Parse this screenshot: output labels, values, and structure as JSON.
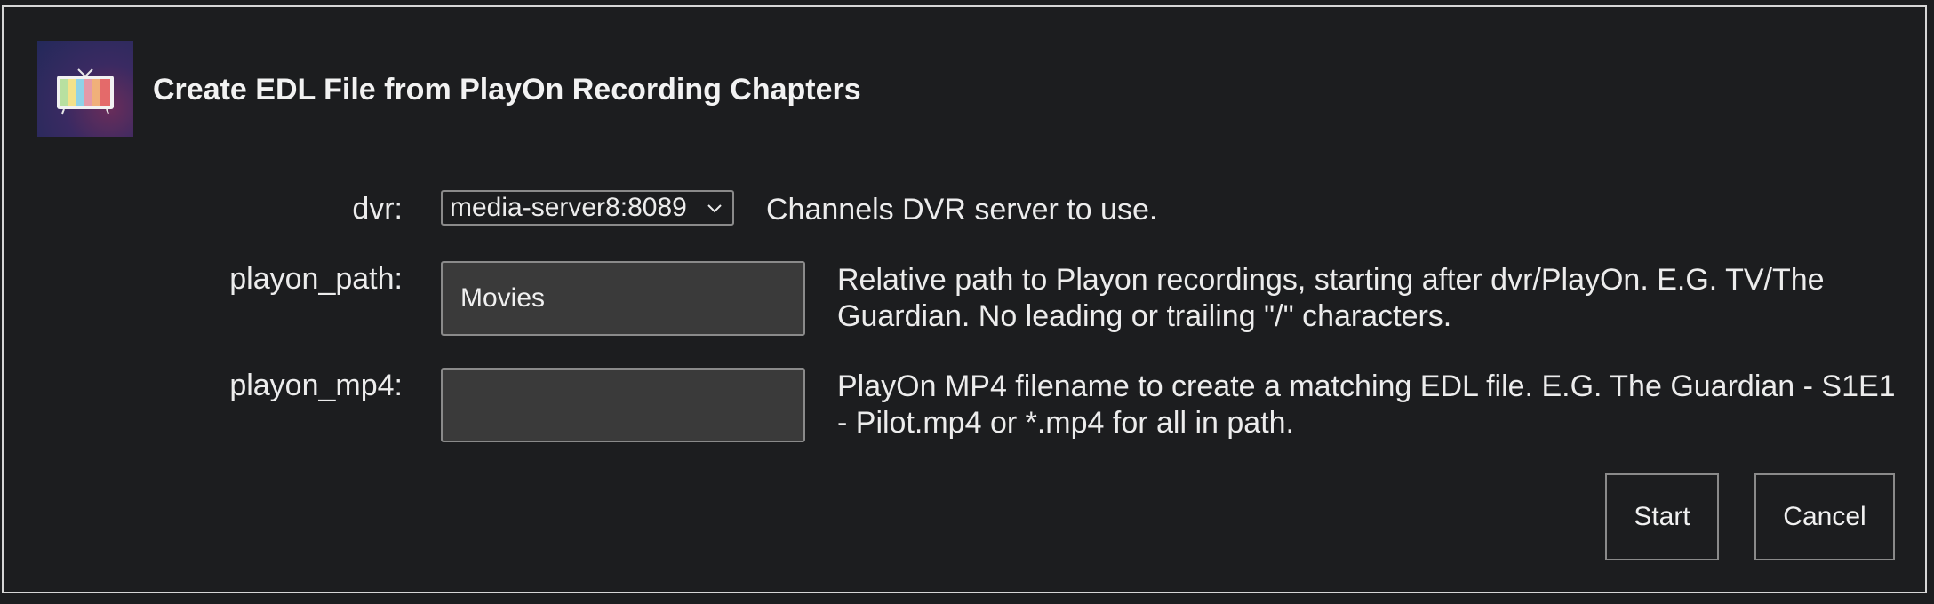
{
  "dialog": {
    "title": "Create EDL File from PlayOn Recording Chapters",
    "icon": "retro-tv-icon"
  },
  "fields": {
    "dvr": {
      "label": "dvr:",
      "value": "media-server8:8089",
      "description": "Channels DVR server to use."
    },
    "playon_path": {
      "label": "playon_path:",
      "value": "Movies",
      "description": "Relative path to Playon recordings, starting after dvr/PlayOn. E.G. TV/The Guardian. No leading or trailing \"/\" characters."
    },
    "playon_mp4": {
      "label": "playon_mp4:",
      "value": "",
      "description": "PlayOn MP4 filename to create a matching EDL file. E.G. The Guardian - S1E1 - Pilot.mp4 or *.mp4 for all in path."
    }
  },
  "buttons": {
    "start": "Start",
    "cancel": "Cancel"
  },
  "colors": {
    "background": "#1c1d1f",
    "input_background": "#3a3a3a",
    "border": "#8a8a8a",
    "text": "#ececec"
  }
}
